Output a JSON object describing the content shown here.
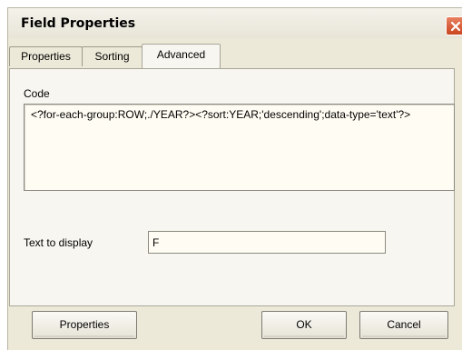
{
  "window": {
    "title": "Field Properties",
    "close_icon": "close-x-icon",
    "close_color": "#d4532a"
  },
  "tabs": [
    {
      "label": "Properties",
      "active": false
    },
    {
      "label": "Sorting",
      "active": false
    },
    {
      "label": "Advanced",
      "active": true
    }
  ],
  "advanced": {
    "code_label": "Code",
    "code_value": "<?for-each-group:ROW;./YEAR?><?sort:YEAR;'descending';data-type='text'?>",
    "display_label": "Text to display",
    "display_value": "F"
  },
  "buttons": {
    "properties": "Properties",
    "ok": "OK",
    "cancel": "Cancel"
  }
}
